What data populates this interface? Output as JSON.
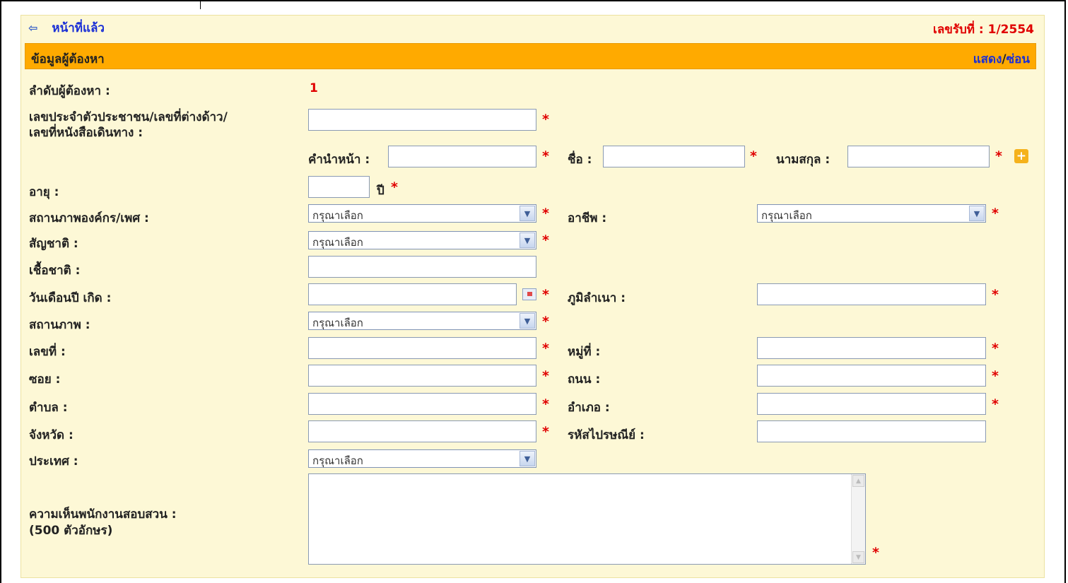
{
  "header": {
    "back_label": "หน้าที่แล้ว",
    "receipt_label": "เลขรับที่ :",
    "receipt_value": "1/2554"
  },
  "section": {
    "title": "ข้อมูลผู้ต้องหา",
    "show_label": "แสดง",
    "separator": "/",
    "hide_label": "ซ่อน"
  },
  "form": {
    "order_label": "ลำดับผู้ต้องหา :",
    "order_value": "1",
    "id_label_line1": "เลขประจำตัวประชาชน/เลขที่ต่างด้าว/",
    "id_label_line2": "เลขที่หนังสือเดินทาง :",
    "prefix_label": "คำนำหน้า :",
    "name_label": "ชื่อ :",
    "surname_label": "นามสกุล :",
    "age_label": "อายุ :",
    "age_unit": "ปี",
    "org_gender_label": "สถานภาพองค์กร/เพศ :",
    "occupation_label": "อาชีพ :",
    "nationality_label": "สัญชาติ :",
    "race_label": "เชื้อชาติ :",
    "dob_label": "วันเดือนปี เกิด :",
    "domicile_label": "ภูมิลำเนา :",
    "marital_label": "สถานภาพ :",
    "house_no_label": "เลขที่ :",
    "moo_label": "หมู่ที่ :",
    "soi_label": "ซอย :",
    "road_label": "ถนน :",
    "subdistrict_label": "ตำบล :",
    "district_label": "อำเภอ :",
    "province_label": "จังหวัด :",
    "postcode_label": "รหัสไปรษณีย์ :",
    "country_label": "ประเทศ :",
    "comment_label_line1": "ความเห็นพนักงานสอบสวน :",
    "comment_label_line2": "(500 ตัวอักษร)",
    "select_placeholder": "กรุณาเลือก",
    "required_mark": "*"
  },
  "colors": {
    "panel_bg": "#fdf8d6",
    "section_bar": "#ffaa00",
    "link": "#1a2fd6",
    "required": "#e00000"
  },
  "icons": {
    "back": "left-arrow-icon",
    "calendar": "calendar-icon",
    "add": "plus-icon",
    "dropdown": "chevron-down-icon"
  }
}
